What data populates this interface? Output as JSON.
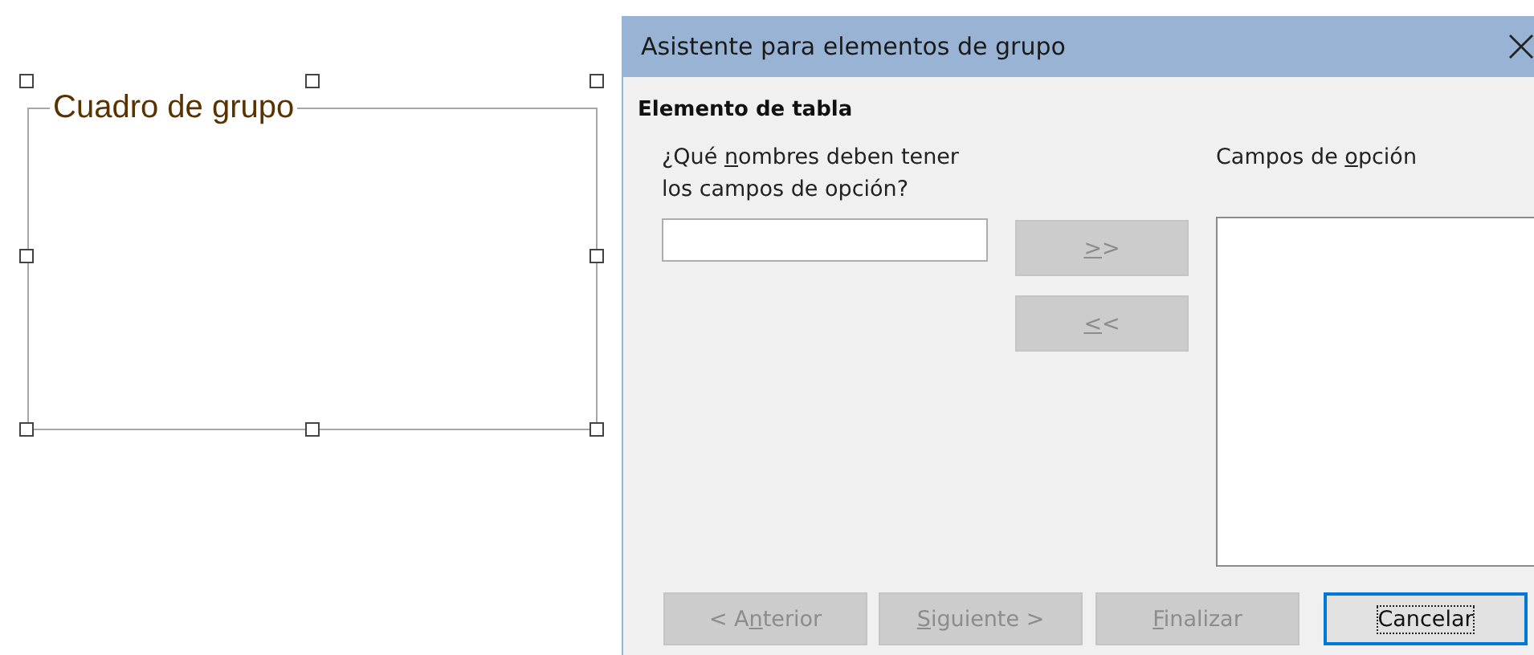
{
  "canvas": {
    "group_box": {
      "label": "Cuadro de grupo",
      "selected": true
    }
  },
  "dialog": {
    "title": "Asistente para elementos de grupo",
    "section": "Elemento de tabla",
    "names_label": {
      "before": "¿Qué ",
      "key": "n",
      "after": "ombres deben tener los campos de opción?"
    },
    "transfer_buttons": [
      {
        "key": ">",
        "after": ">",
        "disabled": true
      },
      {
        "key": "<",
        "after": "<",
        "disabled": true
      }
    ],
    "options_label": {
      "before": "Campos de ",
      "key": "o",
      "after": "pción"
    },
    "footer_buttons": [
      {
        "before": "< A",
        "key": "n",
        "after": "terior",
        "disabled": true,
        "focused": false
      },
      {
        "key": "S",
        "after": "iguiente >",
        "disabled": true,
        "focused": false
      },
      {
        "key": "F",
        "after": "inalizar",
        "disabled": true,
        "focused": false
      },
      {
        "before": "Cancelar",
        "disabled": false,
        "focused": true
      }
    ]
  }
}
